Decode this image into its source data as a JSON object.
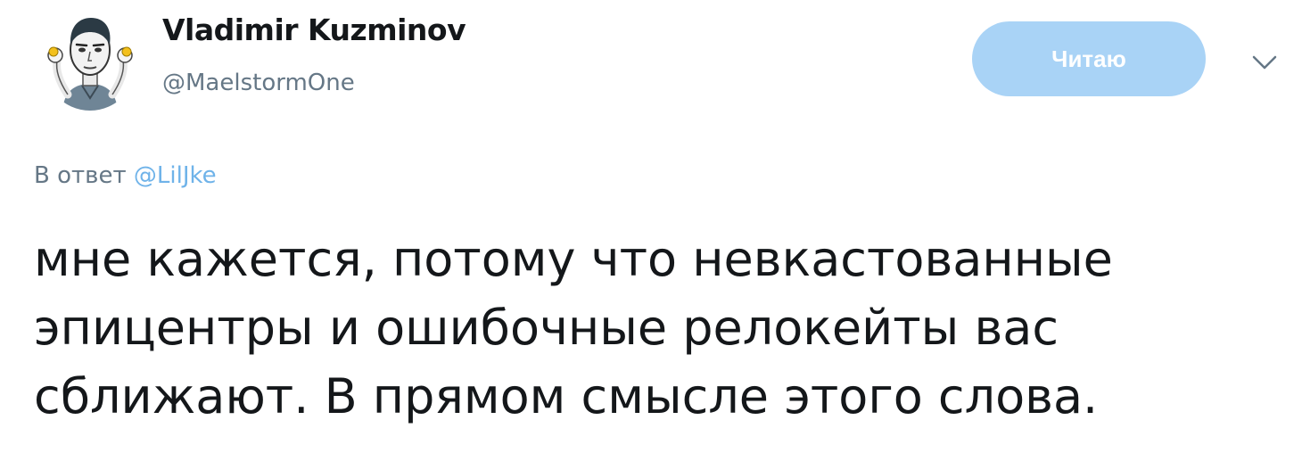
{
  "author": {
    "display_name": "Vladimir Kuzminov",
    "handle": "@MaelstormOne"
  },
  "follow_button": {
    "label": "Читаю",
    "color": "#a9d3f6"
  },
  "menu": {
    "icon": "chevron-down-icon"
  },
  "reply": {
    "prefix": "В ответ",
    "mention": "@LilJke",
    "mention_color": "#6fb3e9"
  },
  "tweet": {
    "lines": [
      "мне кажется, потому что невкастованные",
      "эпицентры и ошибочные релокейты вас",
      "сближают. В прямом смысле этого слова."
    ]
  }
}
